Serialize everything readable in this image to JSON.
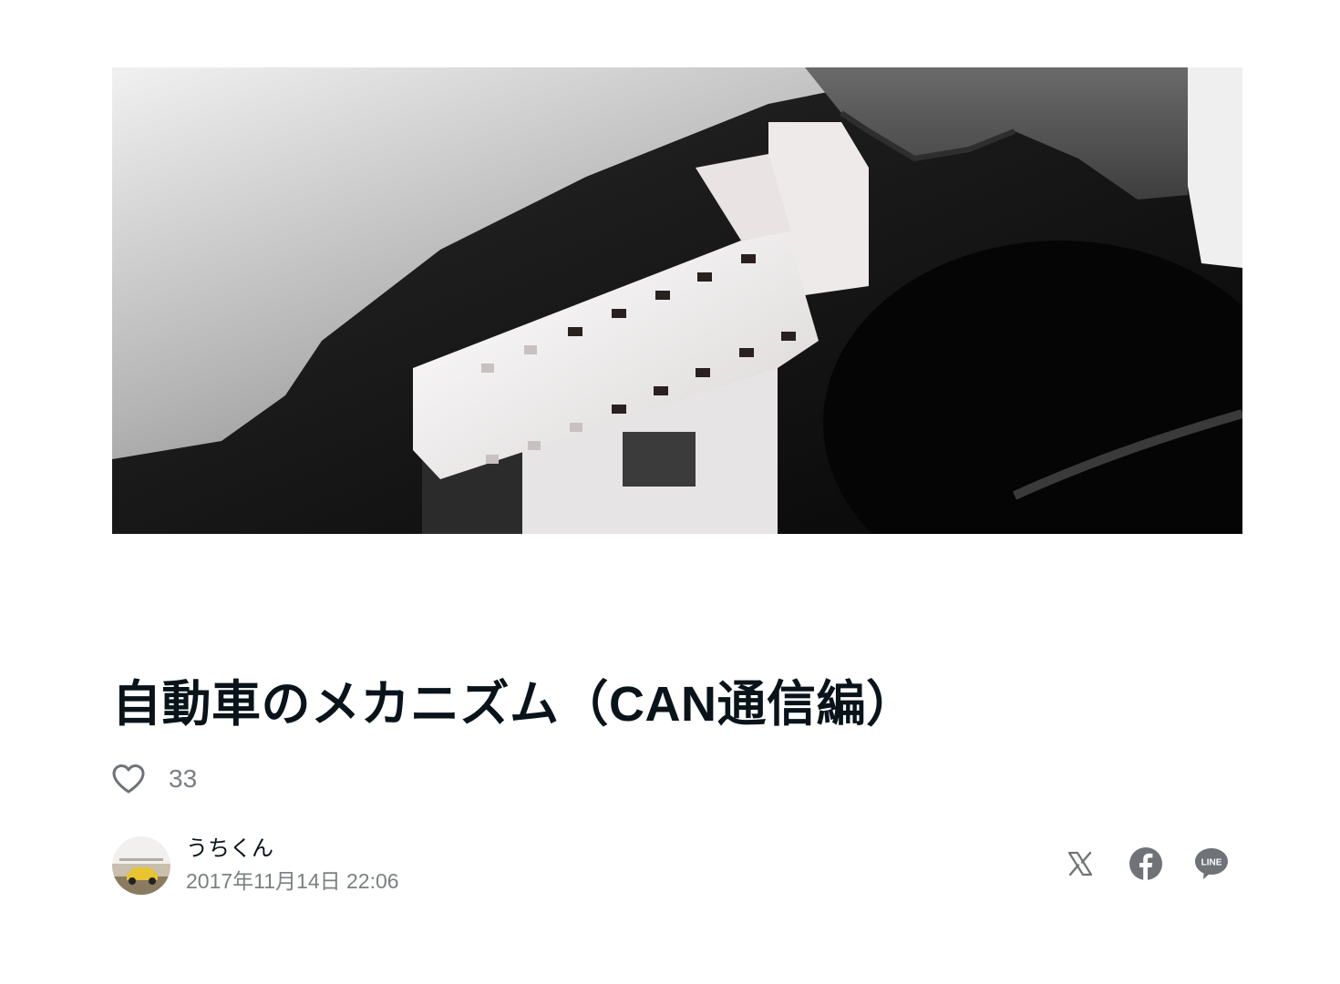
{
  "article": {
    "title": "自動車のメカニズム（CAN通信編）",
    "like_count": "33"
  },
  "author": {
    "name": "うちくん",
    "posted_at": "2017年11月14日 22:06"
  },
  "share": {
    "icons": [
      "x-icon",
      "facebook-icon",
      "line-icon"
    ],
    "line_label": "LINE"
  },
  "hero": {
    "icon": "obd-connector-photo"
  },
  "colors": {
    "text": "#08131a",
    "muted": "#7a7f84",
    "icon": "#6f7378"
  }
}
